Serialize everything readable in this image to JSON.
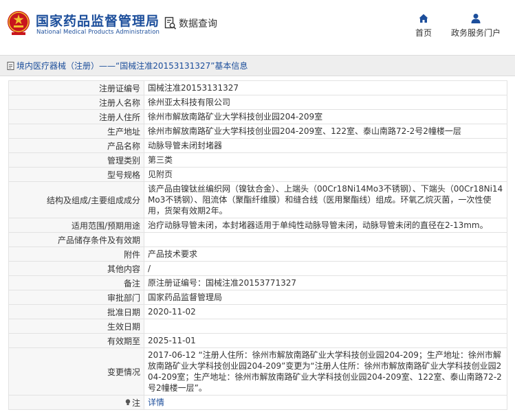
{
  "header": {
    "title_cn": "国家药品监督管理局",
    "title_en": "National Medical Products Administration",
    "data_query_label": "数据查询",
    "nav": [
      {
        "label": "首页",
        "icon": "home-icon"
      },
      {
        "label": "政务服务门户",
        "icon": "user-icon"
      }
    ]
  },
  "breadcrumb": "境内医疗器械（注册）——“国械注准20153131327”基本信息",
  "colors": {
    "brand_blue": "#1c4e9b",
    "emblem_red": "#c8161d",
    "emblem_gold": "#f2c12e"
  },
  "rows": [
    {
      "key": "注册证编号",
      "value": "国械注准20153131327"
    },
    {
      "key": "注册人名称",
      "value": "徐州亚太科技有限公司"
    },
    {
      "key": "注册人住所",
      "value": "徐州市解放南路矿业大学科技创业园204-209室"
    },
    {
      "key": "生产地址",
      "value": "徐州市解放南路矿业大学科技创业园204-209室、122室、泰山南路72-2号2幢楼一层"
    },
    {
      "key": "产品名称",
      "value": "动脉导管未闭封堵器"
    },
    {
      "key": "管理类别",
      "value": "第三类"
    },
    {
      "key": "型号规格",
      "value": "见附页"
    },
    {
      "key": "结构及组成/主要组成成分",
      "value": "该产品由镍钛丝编织网（镍钛合金）、上端头（00Cr18Ni14Mo3不锈钢）、下端头（00Cr18Ni14Mo3不锈钢）、阻流体（聚酯纤维膜）和缝合线（医用聚酯线）组成。环氧乙烷灭菌，一次性使用，货架有效期2年。"
    },
    {
      "key": "适用范围/预期用途",
      "value": "治疗动脉导管未闭，本封堵器适用于单纯性动脉导管未闭，动脉导管未闭的直径在2-13mm。"
    },
    {
      "key": "产品储存条件及有效期",
      "value": ""
    },
    {
      "key": "附件",
      "value": "产品技术要求"
    },
    {
      "key": "其他内容",
      "value": "/"
    },
    {
      "key": "备注",
      "value": "原注册证编号：国械注准20153771327"
    },
    {
      "key": "审批部门",
      "value": "国家药品监督管理局"
    },
    {
      "key": "批准日期",
      "value": "2020-11-02"
    },
    {
      "key": "生效日期",
      "value": ""
    },
    {
      "key": "有效期至",
      "value": "2025-11-01"
    },
    {
      "key": "变更情况",
      "value": "2017-06-12 “注册人住所：徐州市解放南路矿业大学科技创业园204-209；生产地址：徐州市解放南路矿业大学科技创业园204-209”变更为“注册人住所：徐州市解放南路矿业大学科技创业园204-209室；生产地址：徐州市解放南路矿业大学科技创业园204-209室、122室、泰山南路72-2号2幢楼一层”。"
    }
  ],
  "note": {
    "key": "注",
    "value": "详情",
    "icon": "lightbulb-icon"
  }
}
